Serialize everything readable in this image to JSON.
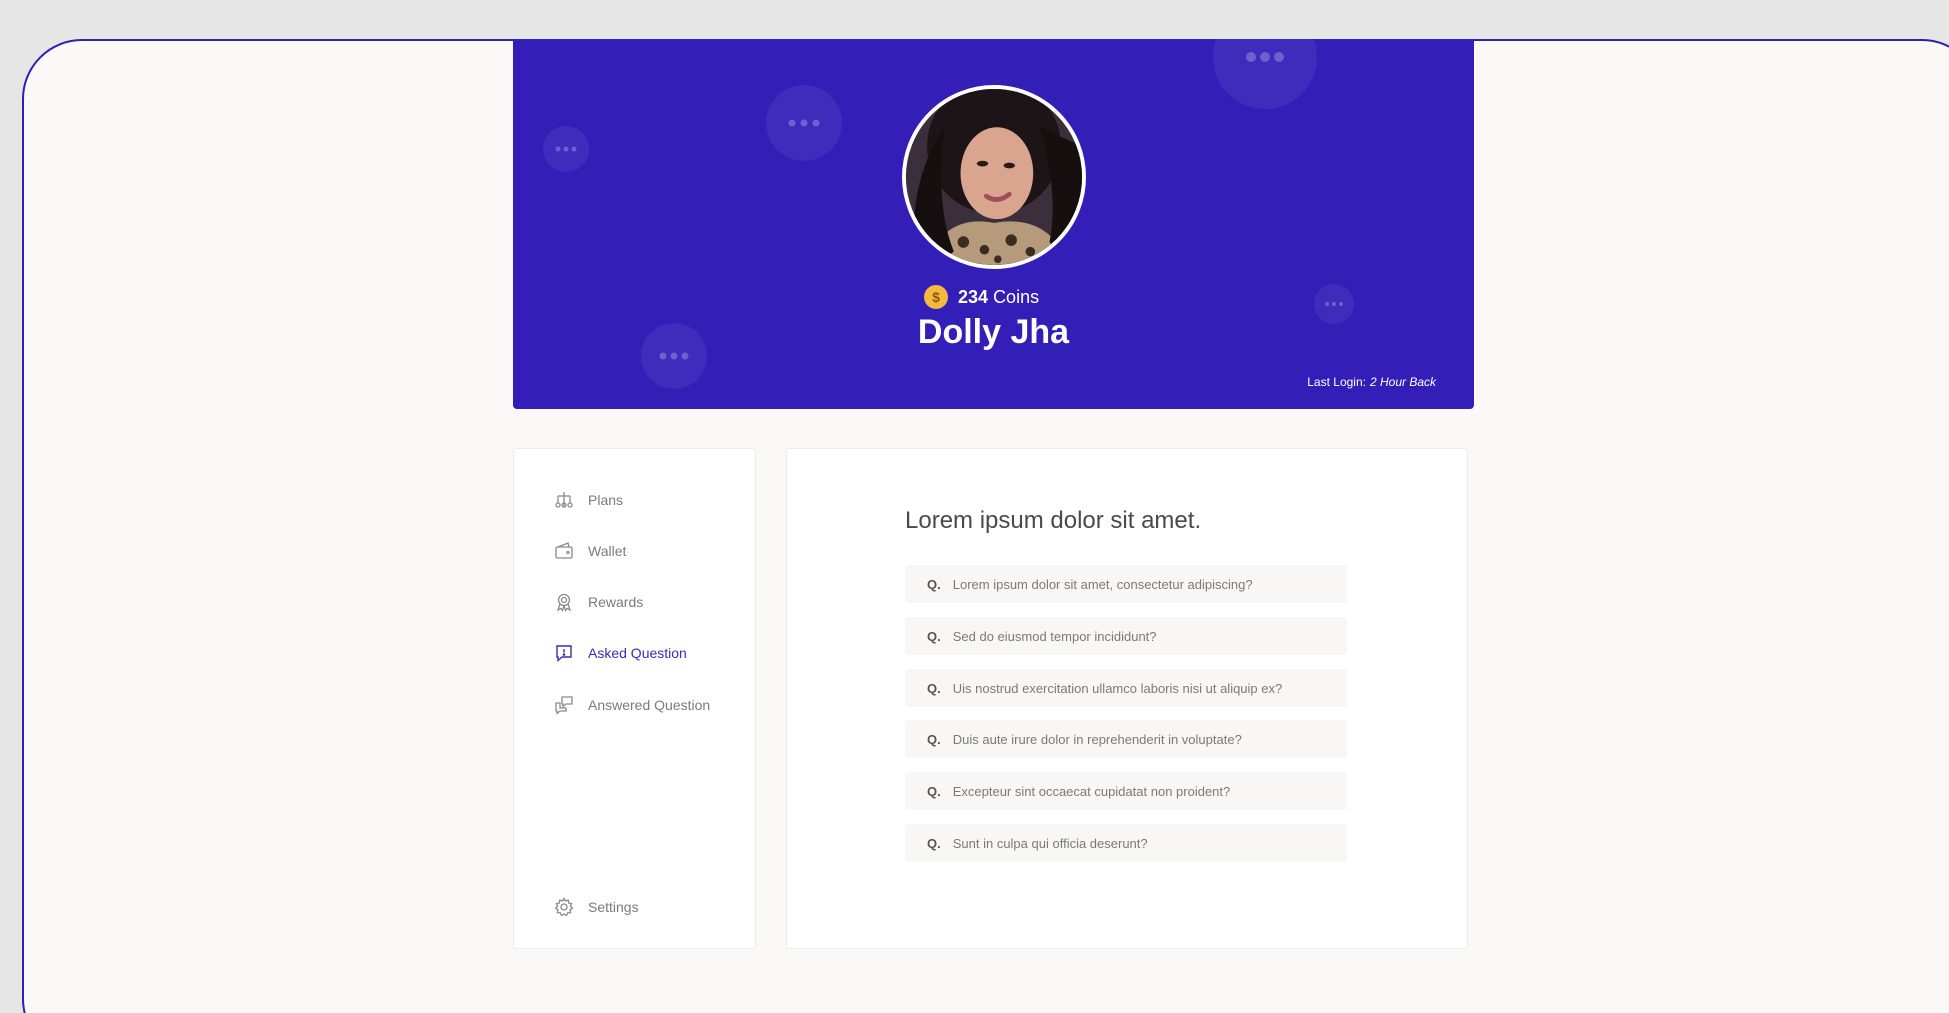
{
  "profile": {
    "coins_value": "234",
    "coins_label": "Coins",
    "name": "Dolly Jha",
    "last_login_label": "Last Login:",
    "last_login_value": "2 Hour Back"
  },
  "sidebar": {
    "items": [
      {
        "label": "Plans",
        "icon": "plans-icon"
      },
      {
        "label": "Wallet",
        "icon": "wallet-icon"
      },
      {
        "label": "Rewards",
        "icon": "rewards-icon"
      },
      {
        "label": "Asked Question",
        "icon": "asked-question-icon",
        "active": true
      },
      {
        "label": "Answered Question",
        "icon": "answered-question-icon"
      }
    ],
    "settings_label": "Settings"
  },
  "main": {
    "title": "Lorem ipsum dolor sit amet.",
    "question_prefix": "Q.",
    "questions": [
      "Lorem ipsum dolor sit amet, consectetur adipiscing?",
      "Sed do eiusmod tempor incididunt?",
      "Uis nostrud exercitation ullamco laboris nisi ut aliquip ex?",
      "Duis aute irure dolor in reprehenderit in voluptate?",
      "Excepteur sint occaecat cupidatat non proident?",
      "Sunt in culpa qui officia deserunt?"
    ]
  },
  "colors": {
    "accent": "#331fb8",
    "coin": "#f5b941",
    "background": "#faf9f7"
  }
}
